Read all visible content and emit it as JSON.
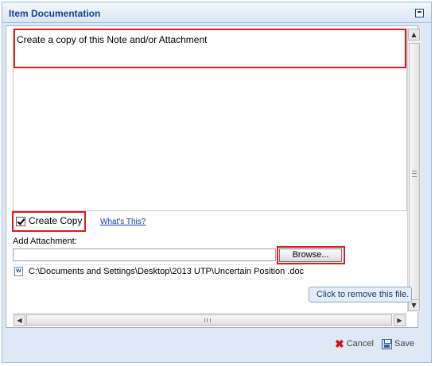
{
  "window": {
    "title": "Item Documentation"
  },
  "note": {
    "text": "Create a copy of this Note and/or Attachment"
  },
  "copy": {
    "label": "Create Copy",
    "checked": true,
    "whats_this": "What's This?"
  },
  "attachment": {
    "label": "Add Attachment:",
    "browse_label": "Browse...",
    "file_path": "C:\\Documents and Settings\\Desktop\\2013 UTP\\Uncertain Position .doc",
    "file_icon": "word-doc-icon"
  },
  "tooltip": {
    "text": "Click to remove this file."
  },
  "footer": {
    "cancel_label": "Cancel",
    "save_label": "Save"
  },
  "colors": {
    "title": "#15428b",
    "highlight": "#e01919",
    "link": "#0645ad",
    "cancel_icon": "#d01313"
  }
}
